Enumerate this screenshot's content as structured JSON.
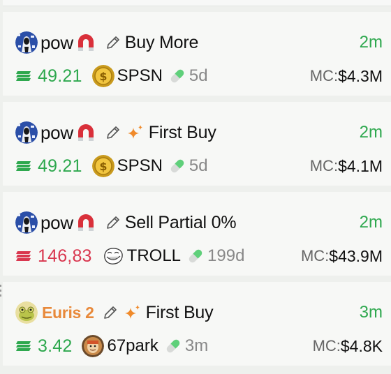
{
  "colors": {
    "green": "#2ea84e",
    "red": "#d9374f",
    "orange": "#e8893a"
  },
  "feed": [
    {
      "user": "pow",
      "user_avatar": "dark-pixel-avatar",
      "badge_icon": "magnet-icon",
      "action": "Buy More",
      "sparkle": false,
      "time": "2m",
      "direction": "buy",
      "amount": "49.21",
      "token": "SPSN",
      "token_icon": "gold-dollar-coin-icon",
      "age": "5d",
      "mc_label": "MC:",
      "mc_value": "$4.3M"
    },
    {
      "user": "pow",
      "user_avatar": "dark-pixel-avatar",
      "badge_icon": "magnet-icon",
      "action": "First Buy",
      "sparkle": true,
      "time": "2m",
      "direction": "buy",
      "amount": "49.21",
      "token": "SPSN",
      "token_icon": "gold-dollar-coin-icon",
      "age": "5d",
      "mc_label": "MC:",
      "mc_value": "$4.1M"
    },
    {
      "user": "pow",
      "user_avatar": "dark-pixel-avatar",
      "badge_icon": "magnet-icon",
      "action": "Sell Partial 0%",
      "sparkle": false,
      "time": "2m",
      "direction": "sell",
      "amount": "146,83",
      "token": "TROLL",
      "token_icon": "trollface-icon",
      "age": "199d",
      "mc_label": "MC:",
      "mc_value": "$43.9M"
    },
    {
      "user": "Euris 2",
      "user_avatar": "yellow-frog-avatar",
      "badge_icon": "",
      "action": "First Buy",
      "sparkle": true,
      "time": "3m",
      "direction": "buy",
      "amount": "3.42",
      "token": "67park",
      "token_icon": "park-character-icon",
      "age": "3m",
      "mc_label": "MC:",
      "mc_value": "$4.8K"
    }
  ]
}
